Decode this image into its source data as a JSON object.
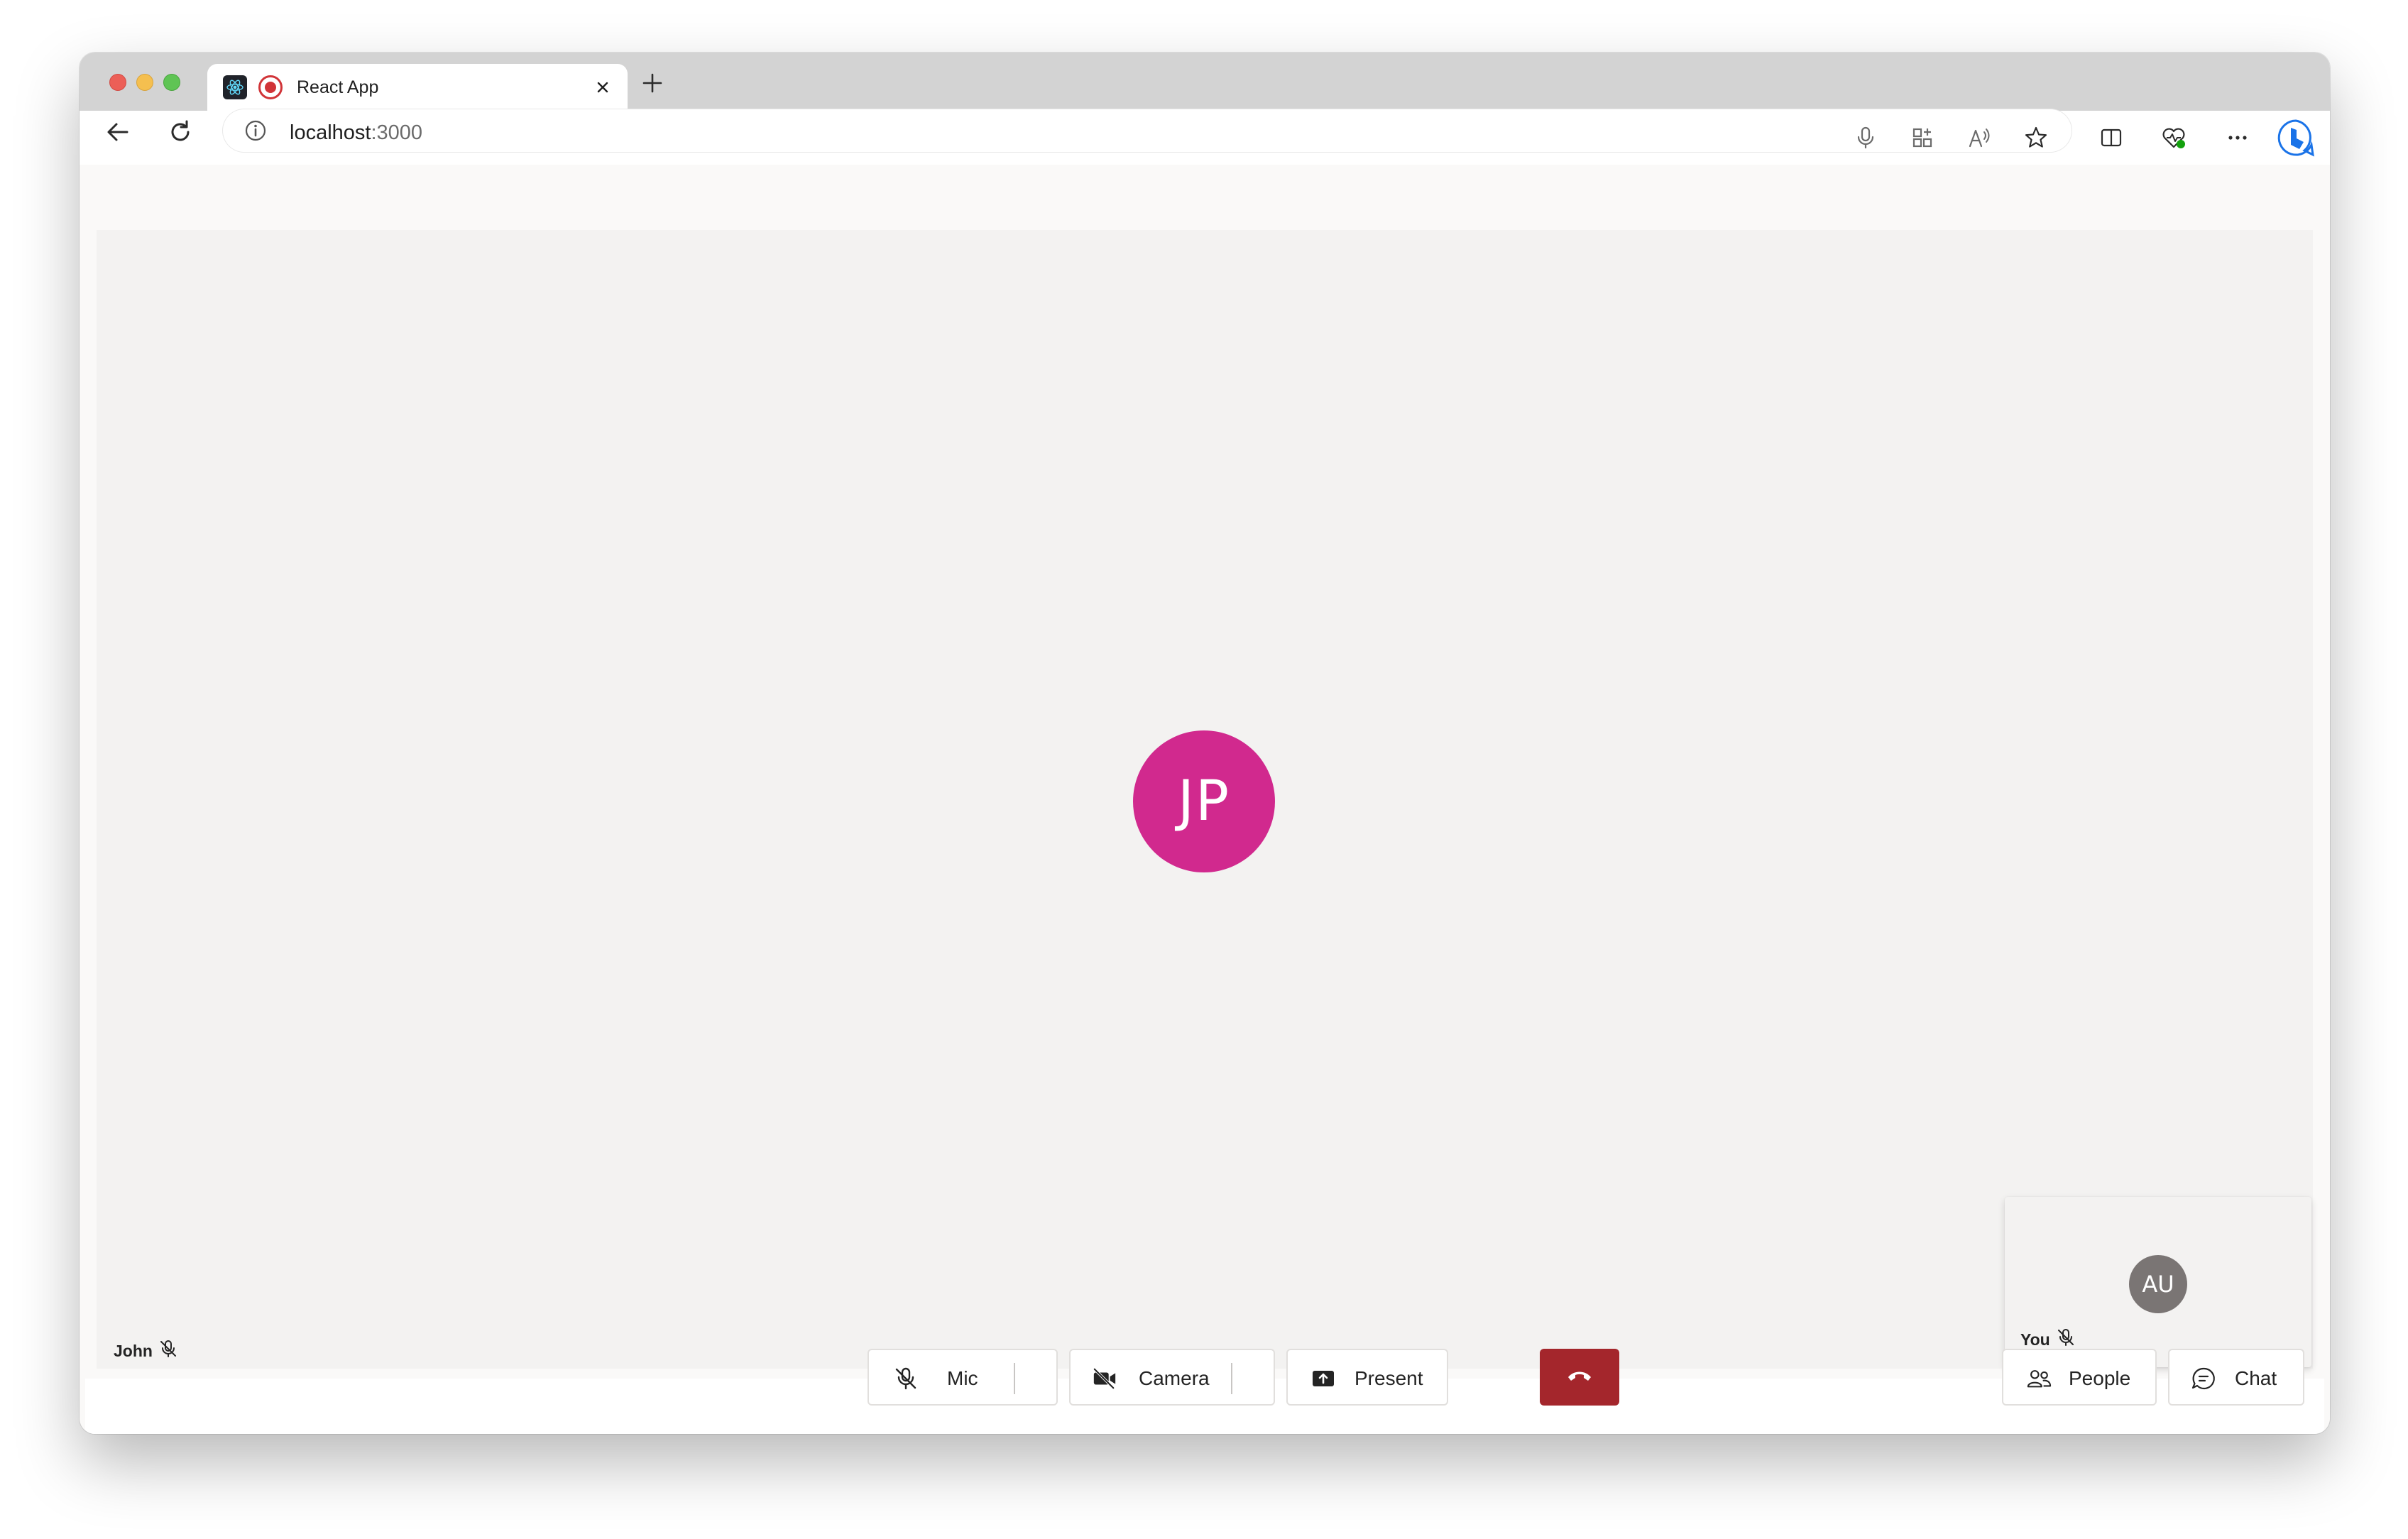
{
  "browser": {
    "tab": {
      "title": "React App",
      "favicon": "react-logo-icon",
      "recording_indicator": "recording-icon"
    },
    "address": {
      "host": "localhost",
      "port": ":3000"
    },
    "toolbar_icons": [
      "back-icon",
      "refresh-icon",
      "microphone-icon",
      "apps-icon",
      "read-aloud-icon",
      "favorite-star-icon",
      "split-screen-icon",
      "browser-essentials-icon",
      "more-icon",
      "copilot-icon"
    ]
  },
  "call": {
    "main_participant": {
      "initials": "JP",
      "name": "John",
      "avatar_color": "#d1298e",
      "muted": true
    },
    "self": {
      "initials": "AU",
      "name": "You",
      "avatar_color": "#7a7574",
      "muted": true
    },
    "controls": {
      "mic_label": "Mic",
      "camera_label": "Camera",
      "present_label": "Present",
      "people_label": "People",
      "chat_label": "Chat",
      "hangup_color": "#a4262c"
    }
  }
}
